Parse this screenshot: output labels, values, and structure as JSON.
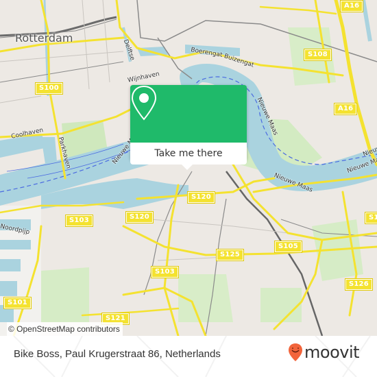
{
  "map": {
    "city_label": "Rotterdam",
    "attribution": "© OpenStreetMap contributors",
    "labels": [
      {
        "text": "Boerengat"
      },
      {
        "text": "Buizengat"
      },
      {
        "text": "Wijnhaven"
      },
      {
        "text": "Delftse"
      },
      {
        "text": "Coolhaven"
      },
      {
        "text": "Parkhaven"
      },
      {
        "text": "Nieuwe Maas"
      },
      {
        "text": "Nieuwe Maas"
      },
      {
        "text": "Nieuwe Maas"
      },
      {
        "text": "Nieuwe Maas"
      },
      {
        "text": "Nieuwe Maas"
      },
      {
        "text": "Noordpijp"
      }
    ],
    "road_shields": [
      {
        "text": "A16"
      },
      {
        "text": "S108"
      },
      {
        "text": "A16"
      },
      {
        "text": "S100"
      },
      {
        "text": "S120"
      },
      {
        "text": "S120"
      },
      {
        "text": "S103"
      },
      {
        "text": "S103"
      },
      {
        "text": "S105"
      },
      {
        "text": "S125"
      },
      {
        "text": "S126"
      },
      {
        "text": "S101"
      },
      {
        "text": "S121"
      },
      {
        "text": "S1"
      }
    ],
    "colors": {
      "water": "#aad3df",
      "land": "#ede9e4",
      "major_road": "#f4e230",
      "park": "#c8e6b0",
      "rail": "#888888"
    }
  },
  "popup": {
    "icon": "map-pin-icon",
    "button_label": "Take me there",
    "accent_color": "#1fba6a"
  },
  "footer": {
    "place_text": "Bike Boss, Paul Krugerstraat 86, Netherlands",
    "brand": "moovit",
    "brand_color": "#f2643b"
  }
}
